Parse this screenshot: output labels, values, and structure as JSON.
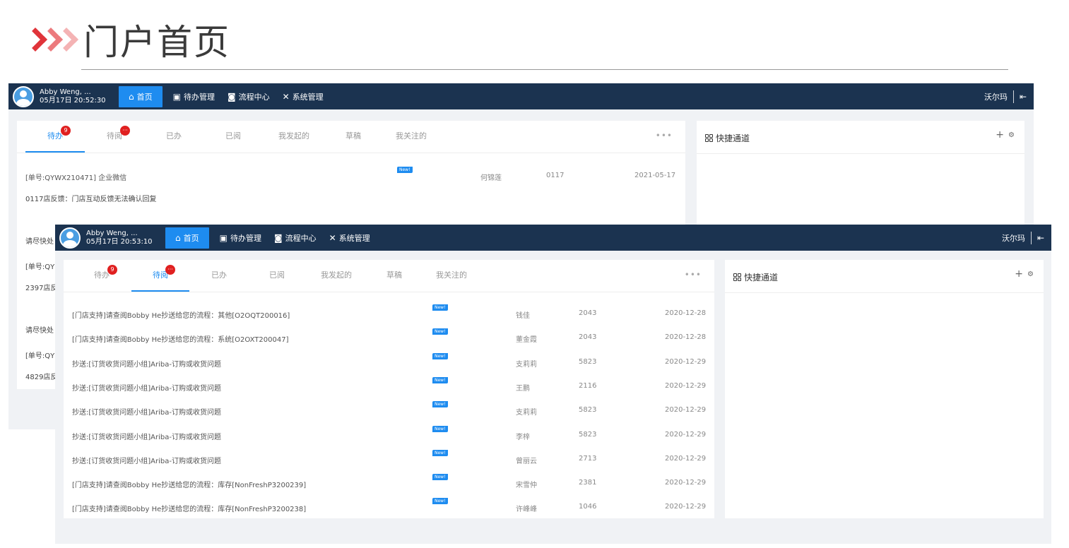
{
  "slide": {
    "title": "门户首页"
  },
  "back_window": {
    "user_name": "Abby Weng, ...",
    "datetime": "05月17日 20:52:30",
    "right_user": "沃尔玛",
    "row1": {
      "title": "[单号:QYWX210471] 企业微信",
      "new": "New!",
      "person": "何锦莲",
      "code": "0117",
      "date": "2021-05-17"
    },
    "row1_desc": "0117店反馈：门店互动反馈无法确认回复",
    "partial_1": "请尽快处",
    "partial_2": "[单号:QY",
    "partial_3": "2397店反",
    "partial_4": "请尽快处",
    "partial_5": "[单号:QY",
    "partial_6": "4829店反"
  },
  "front_window": {
    "user_name": "Abby Weng, ...",
    "datetime": "05月17日 20:53:10",
    "right_user": "沃尔玛"
  },
  "nav": {
    "home": "首页",
    "todo_mgmt": "待办管理",
    "process_center": "流程中心",
    "system_mgmt": "系统管理"
  },
  "tabs": {
    "todo": "待办",
    "todo_count": "9",
    "toread": "待阅",
    "toread_count": "···",
    "done": "已办",
    "read": "已阅",
    "initiated": "我发起的",
    "draft": "草稿",
    "following": "我关注的",
    "more": "•••"
  },
  "quick_access": {
    "title": "快捷通道",
    "add": "+",
    "settings": "⚙"
  },
  "toread_rows": [
    {
      "title": "[门店支持]请查阅Bobby He抄送给您的流程：其他[O2OQT200016]",
      "new": "New!",
      "person": "钱佳",
      "code": "2043",
      "date": "2020-12-28"
    },
    {
      "title": "[门店支持]请查阅Bobby He抄送给您的流程：系统[O2OXT200047]",
      "new": "New!",
      "person": "董金霞",
      "code": "2043",
      "date": "2020-12-28"
    },
    {
      "title": "抄送:[订货收货问题小组]Ariba-订购或收货问题",
      "new": "New!",
      "person": "支莉莉",
      "code": "5823",
      "date": "2020-12-29"
    },
    {
      "title": "抄送:[订货收货问题小组]Ariba-订购或收货问题",
      "new": "New!",
      "person": "王鹏",
      "code": "2116",
      "date": "2020-12-29"
    },
    {
      "title": "抄送:[订货收货问题小组]Ariba-订购或收货问题",
      "new": "New!",
      "person": "支莉莉",
      "code": "5823",
      "date": "2020-12-29"
    },
    {
      "title": "抄送:[订货收货问题小组]Ariba-订购或收货问题",
      "new": "New!",
      "person": "李梓",
      "code": "5823",
      "date": "2020-12-29"
    },
    {
      "title": "抄送:[订货收货问题小组]Ariba-订购或收货问题",
      "new": "New!",
      "person": "曾丽云",
      "code": "2713",
      "date": "2020-12-29"
    },
    {
      "title": "[门店支持]请查阅Bobby He抄送给您的流程：库存[NonFreshP3200239]",
      "new": "New!",
      "person": "宋雪仲",
      "code": "2381",
      "date": "2020-12-29"
    },
    {
      "title": "[门店支持]请查阅Bobby He抄送给您的流程：库存[NonFreshP3200238]",
      "new": "New!",
      "person": "许峰峰",
      "code": "1046",
      "date": "2020-12-29"
    }
  ],
  "colors": {
    "topbar": "#1b3350",
    "accent": "#1e8cf0",
    "badge": "#e02020"
  }
}
